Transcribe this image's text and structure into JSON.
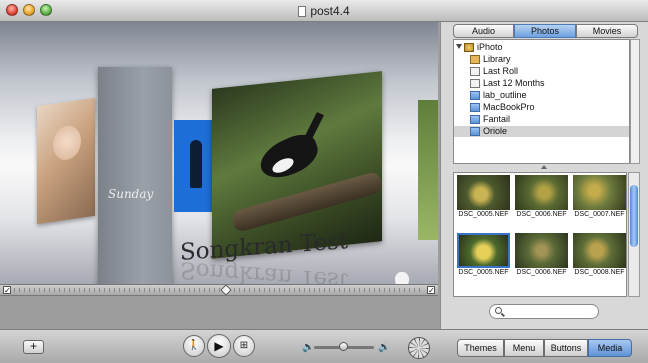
{
  "window": {
    "title": "post4.4"
  },
  "preview": {
    "title": "Songkran Test",
    "sunday_label": "Sunday"
  },
  "media_tabs": {
    "items": [
      {
        "label": "Audio"
      },
      {
        "label": "Photos",
        "selected": true
      },
      {
        "label": "Movies"
      }
    ]
  },
  "sources": {
    "items": [
      {
        "label": "iPhoto",
        "icon": "iphoto-icon"
      },
      {
        "label": "Library",
        "icon": "library-icon"
      },
      {
        "label": "Last Roll",
        "icon": "calendar-icon"
      },
      {
        "label": "Last 12 Months",
        "icon": "calendar-icon"
      },
      {
        "label": "lab_outline",
        "icon": "folder-icon"
      },
      {
        "label": "MacBookPro",
        "icon": "folder-icon"
      },
      {
        "label": "Fantail",
        "icon": "folder-icon"
      },
      {
        "label": "Oriole",
        "icon": "folder-icon",
        "selected": true
      }
    ]
  },
  "thumbnails": {
    "items": [
      {
        "label": "DSC_0005.NEF"
      },
      {
        "label": "DSC_0006.NEF"
      },
      {
        "label": "DSC_0007.NEF"
      },
      {
        "label": "DSC_0005.NEF",
        "selected": true
      },
      {
        "label": "DSC_0006.NEF"
      },
      {
        "label": "DSC_0008.NEF"
      }
    ]
  },
  "search": {
    "placeholder": ""
  },
  "toolbar": {
    "add_label": "+",
    "tabs": [
      {
        "label": "Themes"
      },
      {
        "label": "Menu"
      },
      {
        "label": "Buttons"
      },
      {
        "label": "Media",
        "selected": true
      }
    ]
  },
  "colors": {
    "accent": "#5f93d8",
    "selection": "#3b73c9"
  }
}
